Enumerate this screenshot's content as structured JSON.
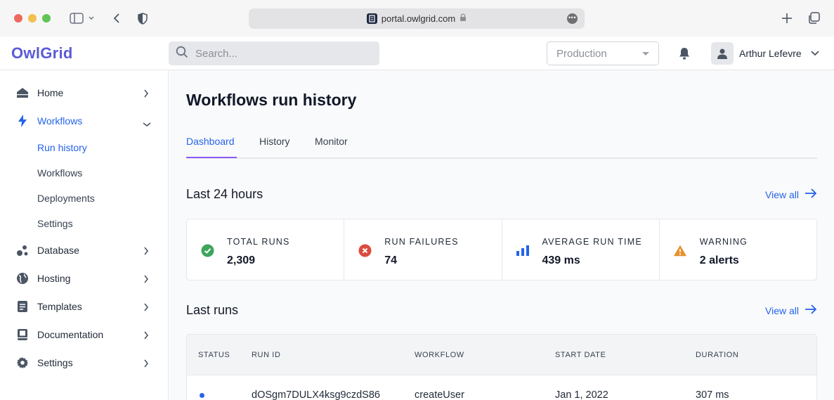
{
  "browser": {
    "url": "portal.owlgrid.com"
  },
  "header": {
    "logo": "OwlGrid",
    "search_placeholder": "Search...",
    "environment": "Production",
    "user_name": "Arthur Lefevre"
  },
  "sidebar": {
    "items": [
      {
        "label": "Home",
        "icon": "home-icon"
      },
      {
        "label": "Workflows",
        "icon": "lightning-icon",
        "expanded": true
      },
      {
        "label": "Database",
        "icon": "database-icon"
      },
      {
        "label": "Hosting",
        "icon": "globe-icon"
      },
      {
        "label": "Templates",
        "icon": "document-icon"
      },
      {
        "label": "Documentation",
        "icon": "book-icon"
      },
      {
        "label": "Settings",
        "icon": "gear-icon"
      }
    ],
    "subitems": [
      "Run history",
      "Workflows",
      "Deployments",
      "Settings"
    ]
  },
  "main": {
    "title": "Workflows run history",
    "tabs": [
      "Dashboard",
      "History",
      "Monitor"
    ],
    "active_tab": "Dashboard",
    "last24": {
      "title": "Last 24 hours",
      "view_all": "View all"
    },
    "stats": [
      {
        "label": "TOTAL RUNS",
        "value": "2,309",
        "icon": "check-circle-icon",
        "color": "#3fa55c"
      },
      {
        "label": "RUN FAILURES",
        "value": "74",
        "icon": "x-circle-icon",
        "color": "#dc4c3e"
      },
      {
        "label": "AVERAGE RUN TIME",
        "value": "439 ms",
        "icon": "bar-chart-icon",
        "color": "#2563eb"
      },
      {
        "label": "WARNING",
        "value": "2 alerts",
        "icon": "warning-icon",
        "color": "#e6902f"
      }
    ],
    "last_runs": {
      "title": "Last runs",
      "view_all": "View all",
      "columns": [
        "STATUS",
        "RUN ID",
        "WORKFLOW",
        "START DATE",
        "DURATION"
      ],
      "rows": [
        {
          "run_id": "dOSgm7DULX4ksg9czdS86",
          "workflow": "createUser",
          "start_date": "Jan 1, 2022",
          "duration": "307 ms"
        }
      ]
    }
  },
  "colors": {
    "accent": "#2563eb",
    "brand": "#5b5bd6",
    "tab_underline": "#8b5cf6"
  }
}
